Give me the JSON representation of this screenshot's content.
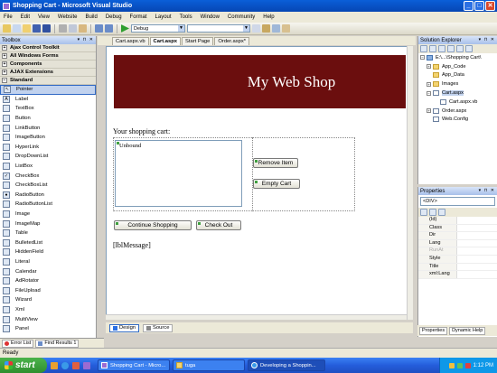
{
  "window": {
    "title": "Shopping Cart - Microsoft Visual Studio",
    "minimize": "_",
    "maximize": "□",
    "close": "✕"
  },
  "menu": [
    "File",
    "Edit",
    "View",
    "Website",
    "Build",
    "Debug",
    "Format",
    "Layout",
    "Tools",
    "Window",
    "Community",
    "Help"
  ],
  "toolbar": {
    "config_value": "Debug"
  },
  "toolbox": {
    "title": "Toolbox",
    "groups": [
      {
        "label": "Ajax Control Toolkit",
        "expanded": false
      },
      {
        "label": "All Windows Forms",
        "expanded": false
      },
      {
        "label": "Components",
        "expanded": false
      },
      {
        "label": "AJAX Extensions",
        "expanded": false
      },
      {
        "label": "Standard",
        "expanded": true
      }
    ],
    "items": [
      "Pointer",
      "Label",
      "TextBox",
      "Button",
      "LinkButton",
      "ImageButton",
      "HyperLink",
      "DropDownList",
      "ListBox",
      "CheckBox",
      "CheckBoxList",
      "RadioButton",
      "RadioButtonList",
      "Image",
      "ImageMap",
      "Table",
      "BulletedList",
      "HiddenField",
      "Literal",
      "Calendar",
      "AdRotator",
      "FileUpload",
      "Wizard",
      "Xml",
      "MultiView",
      "Panel"
    ]
  },
  "left_tabs": [
    "Error List",
    "Find Results 1"
  ],
  "document_tabs": [
    {
      "label": "Cart.aspx.vb",
      "active": false
    },
    {
      "label": "Cart.aspx",
      "active": true
    },
    {
      "label": "Start Page",
      "active": false
    },
    {
      "label": "Order.aspx*",
      "active": false
    }
  ],
  "design": {
    "banner_title": "My Web Shop",
    "cart_label": "Your shopping cart:",
    "listbox_text": "Unbound",
    "remove_button": "Remove Item",
    "empty_button": "Empty Cart",
    "continue_button": "Continue Shopping",
    "checkout_button": "Check Out",
    "message_label": "[lblMessage]",
    "banner_color": "#6b0e0e"
  },
  "view_tabs": {
    "design": "Design",
    "source": "Source"
  },
  "solution_explorer": {
    "title": "Solution Explorer",
    "nodes": [
      {
        "label": "E:\\...\\Shopping Cart\\",
        "indent": 0,
        "type": "root"
      },
      {
        "label": "App_Code",
        "indent": 1,
        "type": "folder"
      },
      {
        "label": "App_Data",
        "indent": 1,
        "type": "folder"
      },
      {
        "label": "Images",
        "indent": 1,
        "type": "folder"
      },
      {
        "label": "Cart.aspx",
        "indent": 1,
        "type": "file",
        "selected": true
      },
      {
        "label": "Cart.aspx.vb",
        "indent": 2,
        "type": "file"
      },
      {
        "label": "Order.aspx",
        "indent": 1,
        "type": "file"
      },
      {
        "label": "Web.Config",
        "indent": 1,
        "type": "file"
      }
    ]
  },
  "properties": {
    "title": "Properties",
    "selected_object": "<DIV>",
    "rows": [
      "(Id)",
      "Class",
      "Dir",
      "Lang",
      "RunAt",
      "Style",
      "Title",
      "xml:Lang"
    ]
  },
  "right_tabs": [
    "Properties",
    "Dynamic Help"
  ],
  "status": {
    "text": "Ready"
  },
  "taskbar": {
    "start_label": "start",
    "tasks": [
      {
        "label": "Shopping Cart - Micro...",
        "icon": "vs-icon",
        "active": false
      },
      {
        "label": "tuga",
        "icon": "folder-icon",
        "active": false
      },
      {
        "label": "Developing a Shoppin...",
        "icon": "ie-icon",
        "active": true
      }
    ],
    "clock": "1:12 PM"
  }
}
